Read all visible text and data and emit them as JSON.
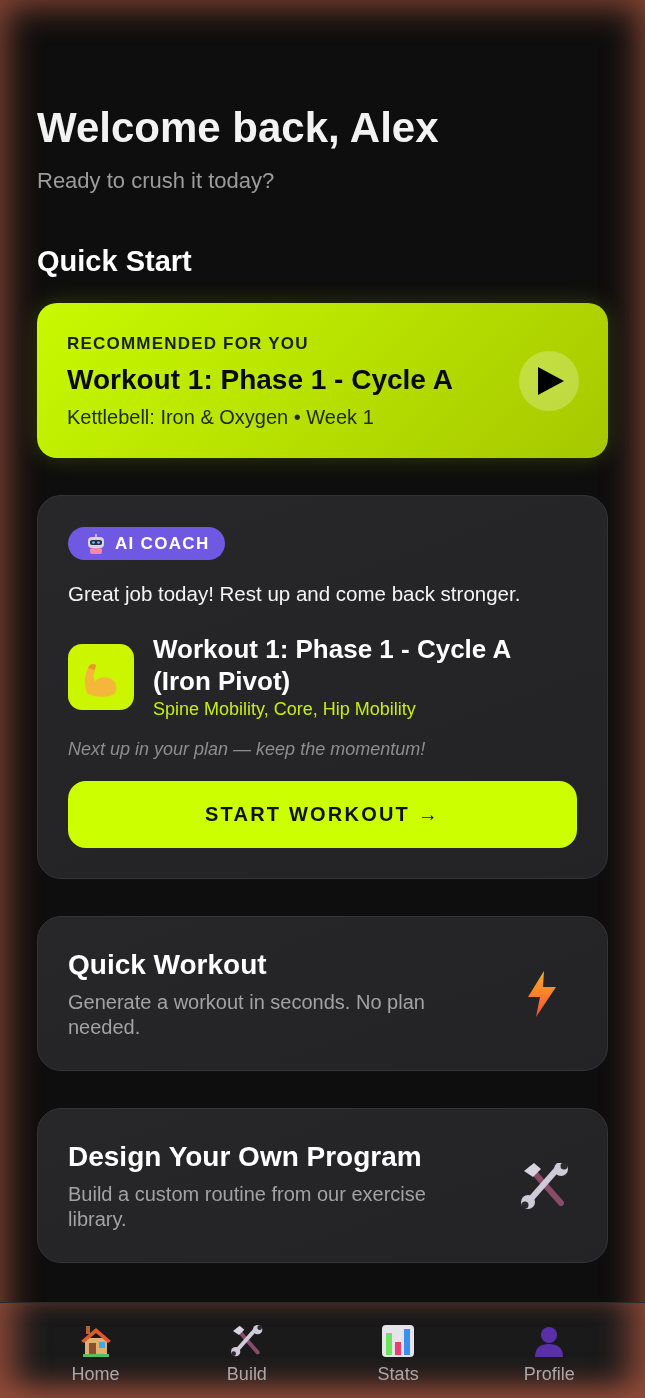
{
  "header": {
    "title": "Welcome back, Alex",
    "subtitle": "Ready to crush it today?"
  },
  "quick_start": {
    "heading": "Quick Start",
    "recommended": {
      "eyebrow": "RECOMMENDED FOR YOU",
      "title": "Workout 1: Phase 1 - Cycle A",
      "subtitle": "Kettlebell: Iron & Oxygen • Week 1"
    }
  },
  "ai_coach": {
    "badge": "AI COACH",
    "message": "Great job today! Rest up and come back stronger.",
    "workout": {
      "title": "Workout 1: Phase 1 - Cycle A (Iron Pivot)",
      "focus": "Spine Mobility, Core, Hip Mobility"
    },
    "note": "Next up in your plan — keep the momentum!",
    "button": "START WORKOUT →"
  },
  "action_cards": [
    {
      "kind": "quick",
      "title": "Quick Workout",
      "description": "Generate a workout in seconds. No plan needed."
    },
    {
      "kind": "design",
      "title": "Design Your Own Program",
      "description": "Build a custom routine from our exercise library."
    }
  ],
  "bottom_nav": [
    {
      "kind": "home",
      "label": "Home"
    },
    {
      "kind": "build",
      "label": "Build"
    },
    {
      "kind": "stats",
      "label": "Stats"
    },
    {
      "kind": "profile",
      "label": "Profile"
    }
  ]
}
